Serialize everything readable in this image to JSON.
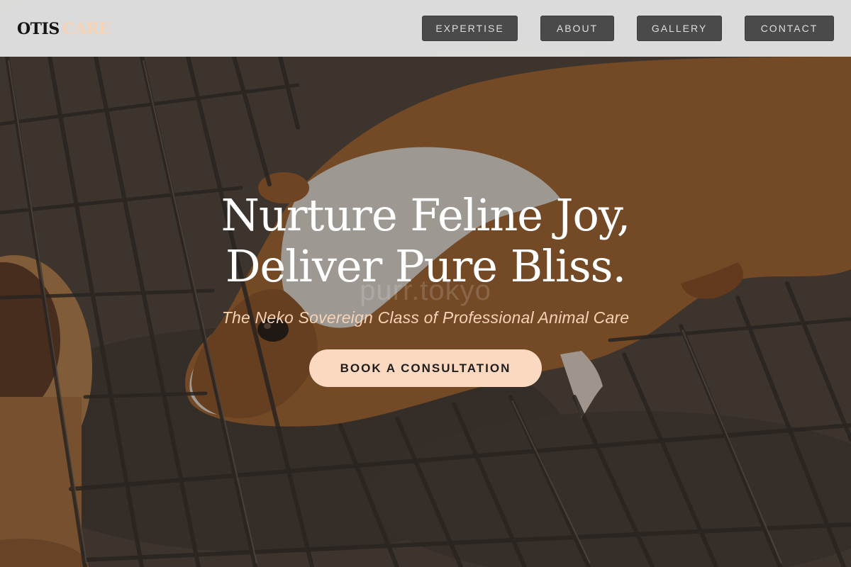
{
  "header": {
    "logo_primary": "OTIS",
    "logo_accent": "CARE",
    "nav": [
      {
        "label": "EXPERTISE"
      },
      {
        "label": "ABOUT"
      },
      {
        "label": "GALLERY"
      },
      {
        "label": "CONTACT"
      }
    ]
  },
  "hero": {
    "title_line_1": "Nurture Feline Joy,",
    "title_line_2": "Deliver Pure Bliss.",
    "watermark": "purr.tokyo",
    "subtitle": "The Neko Sovereign Class of Professional Animal Care",
    "cta_label": "BOOK A CONSULTATION",
    "background_image": "guinea-pig-on-wire-grate-photo"
  },
  "colors": {
    "accent": "#f6d3b5",
    "cta_background": "#fbd9c1",
    "nav_button_background": "#4a4a4a",
    "header_background": "#e8e8e8"
  }
}
